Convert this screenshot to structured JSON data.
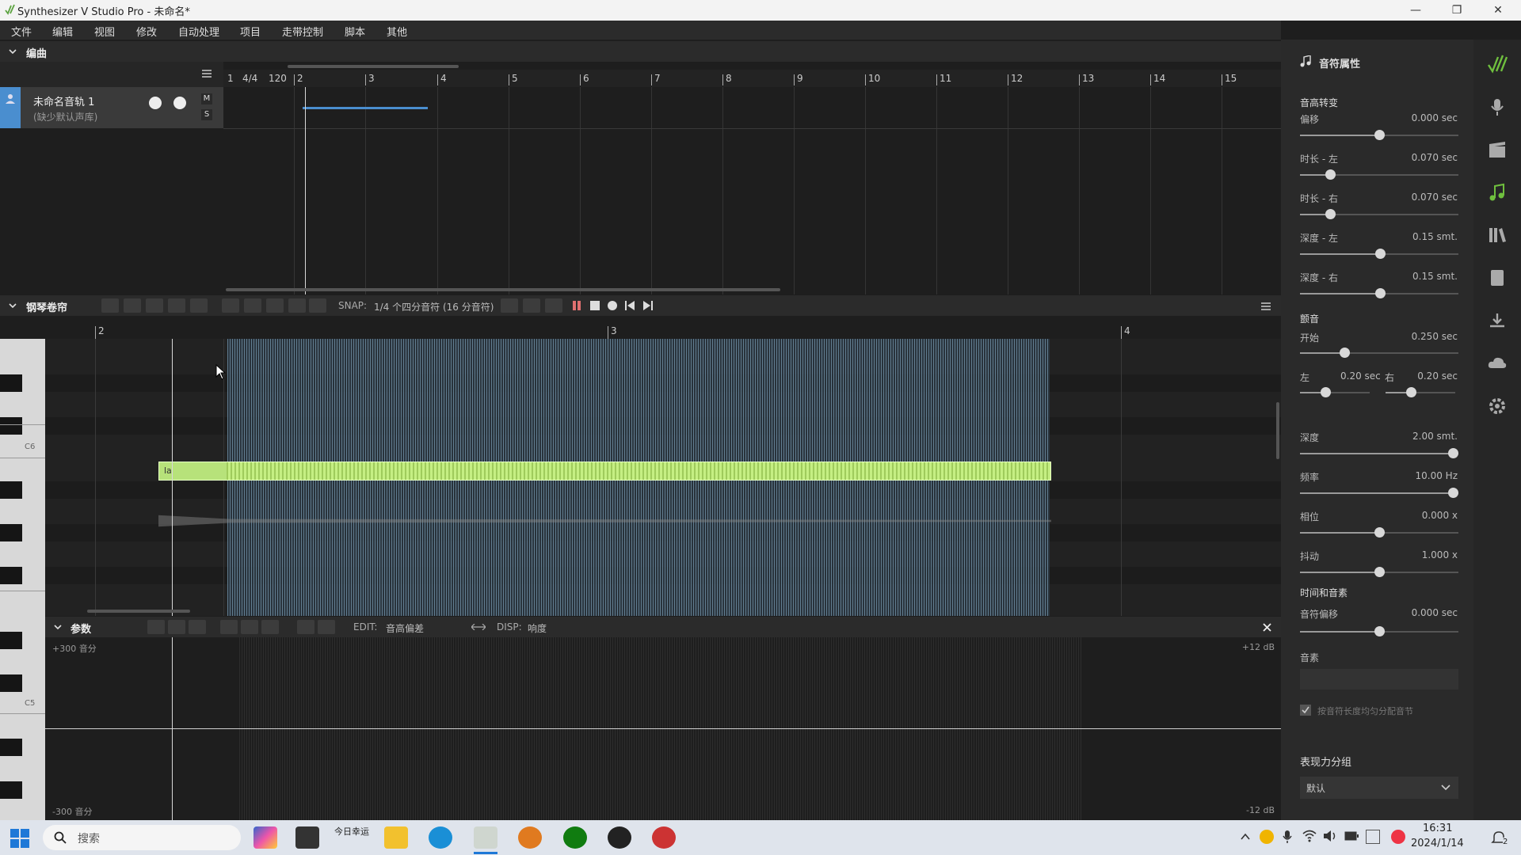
{
  "window": {
    "title": "Synthesizer V Studio Pro - 未命名*"
  },
  "menu": [
    "文件",
    "编辑",
    "视图",
    "修改",
    "自动处理",
    "项目",
    "走带控制",
    "脚本",
    "其他"
  ],
  "arrangement": {
    "header": "编曲",
    "time_signature": "4/4",
    "tempo": "120",
    "ruler": [
      "1",
      "2",
      "3",
      "4",
      "5",
      "6",
      "7",
      "8",
      "9",
      "10",
      "11",
      "12",
      "13",
      "14",
      "15"
    ],
    "track": {
      "name": "未命名音轨 1",
      "subtitle": "(缺少默认声库)",
      "mute": "M",
      "solo": "S"
    }
  },
  "piano_roll": {
    "header": "钢琴卷帘",
    "snap_label": "SNAP:",
    "snap_value": "1/4 个四分音符 (16 分音符)",
    "ruler": [
      "2",
      "3",
      "4"
    ],
    "key_labels": [
      "C6",
      "C5"
    ],
    "note_lyric": "la"
  },
  "params": {
    "header": "参数",
    "edit_label": "EDIT:",
    "edit_value": "音高偏差",
    "disp_label": "DISP:",
    "disp_value": "响度",
    "top_left": "+300 音分",
    "bottom_left": "-300 音分",
    "top_right": "+12 dB",
    "bottom_right": "-12 dB"
  },
  "note_properties": {
    "title": "音符属性",
    "pitch_transition": {
      "header": "音高转变",
      "items": [
        {
          "label": "偏移",
          "value": "0.000 sec",
          "level": 0.5
        },
        {
          "label": "时长 - 左",
          "value": "0.070 sec",
          "level": 0.17
        },
        {
          "label": "时长 - 右",
          "value": "0.070 sec",
          "level": 0.17
        },
        {
          "label": "深度 - 左",
          "value": "0.15 smt.",
          "level": 0.51
        },
        {
          "label": "深度 - 右",
          "value": "0.15 smt.",
          "level": 0.51
        }
      ]
    },
    "vibrato": {
      "header": "颤音",
      "start": {
        "label": "开始",
        "value": "0.250 sec",
        "level": 0.27
      },
      "left": {
        "label": "左",
        "value": "0.20 sec",
        "level": 0.35
      },
      "right": {
        "label": "右",
        "value": "0.20 sec",
        "level": 0.35
      },
      "items": [
        {
          "label": "深度",
          "value": "2.00 smt.",
          "level": 1.0
        },
        {
          "label": "频率",
          "value": "10.00 Hz",
          "level": 1.0
        },
        {
          "label": "相位",
          "value": "0.000 x",
          "level": 0.5
        },
        {
          "label": "抖动",
          "value": "1.000 x",
          "level": 0.5
        }
      ]
    },
    "timing": {
      "header": "时间和音素",
      "offset": {
        "label": "音符偏移",
        "value": "0.000 sec",
        "level": 0.5
      },
      "phoneme_label": "音素",
      "checkbox_label": "按音符长度均匀分配音节"
    },
    "expression": {
      "header": "表现力分组",
      "value": "默认"
    }
  },
  "taskbar": {
    "search_placeholder": "搜索",
    "widget_text": "今日幸运",
    "time": "16:31",
    "date": "2024/1/14",
    "notif": "2"
  },
  "colors": {
    "note": "#b7e27a",
    "waveform": "#6d8ea5",
    "accent_green": "#6fbf3e",
    "track_blue": "#4a8ecf"
  }
}
